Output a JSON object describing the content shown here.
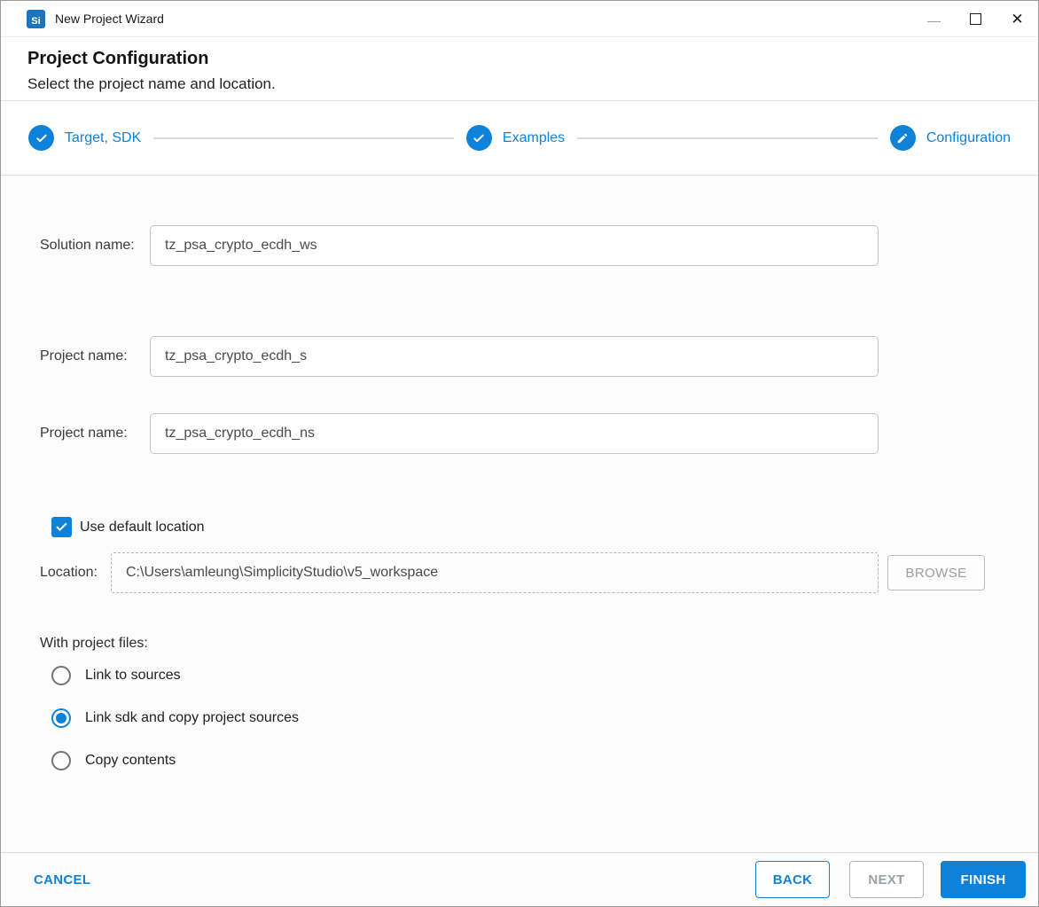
{
  "window": {
    "title": "New Project Wizard",
    "app_icon_text": "Si",
    "controls": {
      "close_glyph": "✕"
    }
  },
  "header": {
    "title": "Project Configuration",
    "subtitle": "Select the project name and location."
  },
  "stepper": {
    "steps": [
      {
        "label": "Target, SDK",
        "state": "complete",
        "icon": "check-icon"
      },
      {
        "label": "Examples",
        "state": "complete",
        "icon": "check-icon"
      },
      {
        "label": "Configuration",
        "state": "current",
        "icon": "pencil-icon"
      }
    ]
  },
  "form": {
    "solution_name": {
      "label": "Solution name:",
      "value": "tz_psa_crypto_ecdh_ws"
    },
    "project_name_1": {
      "label": "Project name:",
      "value": "tz_psa_crypto_ecdh_s"
    },
    "project_name_2": {
      "label": "Project name:",
      "value": "tz_psa_crypto_ecdh_ns"
    },
    "use_default_location": {
      "label": "Use default location",
      "checked": true
    },
    "location": {
      "label": "Location:",
      "value": "C:\\Users\\amleung\\SimplicityStudio\\v5_workspace",
      "browse_label": "BROWSE"
    },
    "with_project_files": {
      "label": "With project files:",
      "options": [
        {
          "label": "Link to sources",
          "selected": false
        },
        {
          "label": "Link sdk and copy project sources",
          "selected": true
        },
        {
          "label": "Copy contents",
          "selected": false
        }
      ]
    }
  },
  "footer": {
    "cancel_label": "CANCEL",
    "back_label": "BACK",
    "next_label": "NEXT",
    "finish_label": "FINISH"
  },
  "colors": {
    "accent_blue": "#0e82d8",
    "app_icon_blue": "#1b74bc",
    "disabled_gray": "#9e9e9e"
  }
}
